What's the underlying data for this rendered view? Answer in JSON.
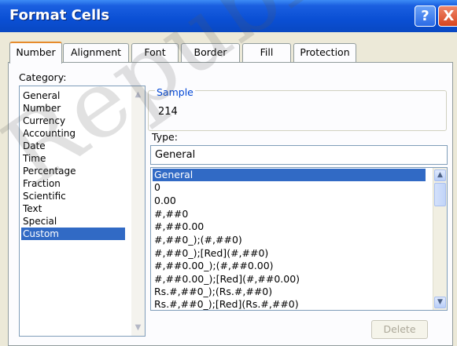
{
  "dialog": {
    "title": "Format Cells",
    "help_glyph": "?",
    "close_glyph": "X"
  },
  "tabs": [
    {
      "label": "Number"
    },
    {
      "label": "Alignment"
    },
    {
      "label": "Font"
    },
    {
      "label": "Border"
    },
    {
      "label": "Fill"
    },
    {
      "label": "Protection"
    }
  ],
  "category": {
    "label": "Category:",
    "items": [
      "General",
      "Number",
      "Currency",
      "Accounting",
      "Date",
      "Time",
      "Percentage",
      "Fraction",
      "Scientific",
      "Text",
      "Special",
      "Custom"
    ],
    "selected": "Custom"
  },
  "sample": {
    "label": "Sample",
    "value": "214"
  },
  "type": {
    "label": "Type:",
    "value": "General",
    "formats": [
      "General",
      "0",
      "0.00",
      "#,##0",
      "#,##0.00",
      "#,##0_);(#,##0)",
      "#,##0_);[Red](#,##0)",
      "#,##0.00_);(#,##0.00)",
      "#,##0.00_);[Red](#,##0.00)",
      "Rs.#,##0_);(Rs.#,##0)",
      "Rs.#,##0_);[Red](Rs.#,##0)"
    ],
    "selected": "General"
  },
  "buttons": {
    "delete": "Delete"
  },
  "watermark": "Republish",
  "colors": {
    "titlebar": "#0a4fd4",
    "selection": "#316ac5",
    "dialog_bg": "#ece9d8",
    "tab_highlight": "#e68b2c"
  }
}
